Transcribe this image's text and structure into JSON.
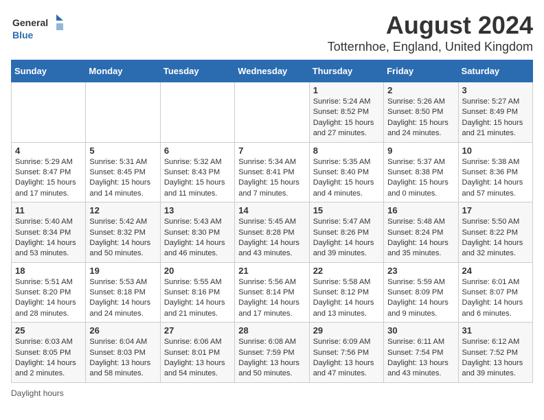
{
  "header": {
    "logo_general": "General",
    "logo_blue": "Blue",
    "main_title": "August 2024",
    "subtitle": "Totternhoe, England, United Kingdom"
  },
  "days_of_week": [
    "Sunday",
    "Monday",
    "Tuesday",
    "Wednesday",
    "Thursday",
    "Friday",
    "Saturday"
  ],
  "weeks": [
    [
      {
        "day": "",
        "info": ""
      },
      {
        "day": "",
        "info": ""
      },
      {
        "day": "",
        "info": ""
      },
      {
        "day": "",
        "info": ""
      },
      {
        "day": "1",
        "info": "Sunrise: 5:24 AM\nSunset: 8:52 PM\nDaylight: 15 hours and 27 minutes."
      },
      {
        "day": "2",
        "info": "Sunrise: 5:26 AM\nSunset: 8:50 PM\nDaylight: 15 hours and 24 minutes."
      },
      {
        "day": "3",
        "info": "Sunrise: 5:27 AM\nSunset: 8:49 PM\nDaylight: 15 hours and 21 minutes."
      }
    ],
    [
      {
        "day": "4",
        "info": "Sunrise: 5:29 AM\nSunset: 8:47 PM\nDaylight: 15 hours and 17 minutes."
      },
      {
        "day": "5",
        "info": "Sunrise: 5:31 AM\nSunset: 8:45 PM\nDaylight: 15 hours and 14 minutes."
      },
      {
        "day": "6",
        "info": "Sunrise: 5:32 AM\nSunset: 8:43 PM\nDaylight: 15 hours and 11 minutes."
      },
      {
        "day": "7",
        "info": "Sunrise: 5:34 AM\nSunset: 8:41 PM\nDaylight: 15 hours and 7 minutes."
      },
      {
        "day": "8",
        "info": "Sunrise: 5:35 AM\nSunset: 8:40 PM\nDaylight: 15 hours and 4 minutes."
      },
      {
        "day": "9",
        "info": "Sunrise: 5:37 AM\nSunset: 8:38 PM\nDaylight: 15 hours and 0 minutes."
      },
      {
        "day": "10",
        "info": "Sunrise: 5:38 AM\nSunset: 8:36 PM\nDaylight: 14 hours and 57 minutes."
      }
    ],
    [
      {
        "day": "11",
        "info": "Sunrise: 5:40 AM\nSunset: 8:34 PM\nDaylight: 14 hours and 53 minutes."
      },
      {
        "day": "12",
        "info": "Sunrise: 5:42 AM\nSunset: 8:32 PM\nDaylight: 14 hours and 50 minutes."
      },
      {
        "day": "13",
        "info": "Sunrise: 5:43 AM\nSunset: 8:30 PM\nDaylight: 14 hours and 46 minutes."
      },
      {
        "day": "14",
        "info": "Sunrise: 5:45 AM\nSunset: 8:28 PM\nDaylight: 14 hours and 43 minutes."
      },
      {
        "day": "15",
        "info": "Sunrise: 5:47 AM\nSunset: 8:26 PM\nDaylight: 14 hours and 39 minutes."
      },
      {
        "day": "16",
        "info": "Sunrise: 5:48 AM\nSunset: 8:24 PM\nDaylight: 14 hours and 35 minutes."
      },
      {
        "day": "17",
        "info": "Sunrise: 5:50 AM\nSunset: 8:22 PM\nDaylight: 14 hours and 32 minutes."
      }
    ],
    [
      {
        "day": "18",
        "info": "Sunrise: 5:51 AM\nSunset: 8:20 PM\nDaylight: 14 hours and 28 minutes."
      },
      {
        "day": "19",
        "info": "Sunrise: 5:53 AM\nSunset: 8:18 PM\nDaylight: 14 hours and 24 minutes."
      },
      {
        "day": "20",
        "info": "Sunrise: 5:55 AM\nSunset: 8:16 PM\nDaylight: 14 hours and 21 minutes."
      },
      {
        "day": "21",
        "info": "Sunrise: 5:56 AM\nSunset: 8:14 PM\nDaylight: 14 hours and 17 minutes."
      },
      {
        "day": "22",
        "info": "Sunrise: 5:58 AM\nSunset: 8:12 PM\nDaylight: 14 hours and 13 minutes."
      },
      {
        "day": "23",
        "info": "Sunrise: 5:59 AM\nSunset: 8:09 PM\nDaylight: 14 hours and 9 minutes."
      },
      {
        "day": "24",
        "info": "Sunrise: 6:01 AM\nSunset: 8:07 PM\nDaylight: 14 hours and 6 minutes."
      }
    ],
    [
      {
        "day": "25",
        "info": "Sunrise: 6:03 AM\nSunset: 8:05 PM\nDaylight: 14 hours and 2 minutes."
      },
      {
        "day": "26",
        "info": "Sunrise: 6:04 AM\nSunset: 8:03 PM\nDaylight: 13 hours and 58 minutes."
      },
      {
        "day": "27",
        "info": "Sunrise: 6:06 AM\nSunset: 8:01 PM\nDaylight: 13 hours and 54 minutes."
      },
      {
        "day": "28",
        "info": "Sunrise: 6:08 AM\nSunset: 7:59 PM\nDaylight: 13 hours and 50 minutes."
      },
      {
        "day": "29",
        "info": "Sunrise: 6:09 AM\nSunset: 7:56 PM\nDaylight: 13 hours and 47 minutes."
      },
      {
        "day": "30",
        "info": "Sunrise: 6:11 AM\nSunset: 7:54 PM\nDaylight: 13 hours and 43 minutes."
      },
      {
        "day": "31",
        "info": "Sunrise: 6:12 AM\nSunset: 7:52 PM\nDaylight: 13 hours and 39 minutes."
      }
    ]
  ],
  "footer": {
    "note": "Daylight hours"
  }
}
